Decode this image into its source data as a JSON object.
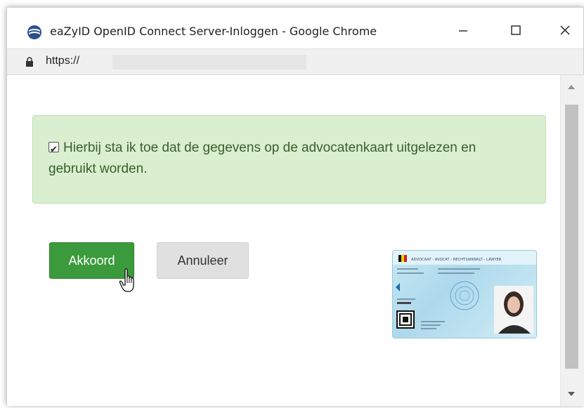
{
  "window": {
    "title": "eaZyID OpenID Connect Server-Inloggen - Google Chrome",
    "minimize_icon": "minimize-icon",
    "maximize_icon": "maximize-icon",
    "close_icon": "close-icon"
  },
  "address": {
    "url": "https://"
  },
  "consent": {
    "checked": true,
    "text": "Hierbij sta ik toe dat de gegevens op de advocatenkaart uitgelezen en gebruikt worden."
  },
  "buttons": {
    "accept_label": "Akkoord",
    "cancel_label": "Annuleer"
  },
  "card": {
    "header": "ADVOCAAT - AVOCAT - RECHTSANWALT - LAWYER"
  },
  "colors": {
    "accept": "#3b9a3b",
    "alert_bg": "#d9efd0",
    "alert_text": "#3a5f2a"
  }
}
